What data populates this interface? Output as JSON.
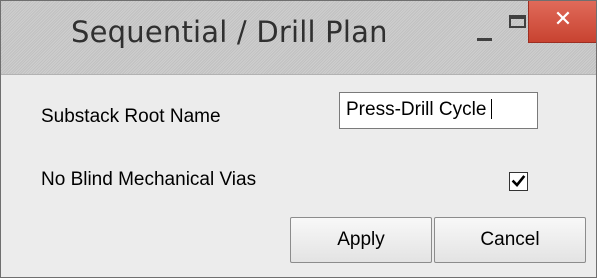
{
  "window": {
    "title": "Sequential / Drill Plan",
    "controls": {
      "minimize_icon": "minimize-icon",
      "maximize_icon": "maximize-icon",
      "close_glyph": "✕",
      "close_color": "#d9533f"
    }
  },
  "form": {
    "substack_root_name": {
      "label": "Substack Root Name",
      "value": "Press-Drill Cycle"
    },
    "no_blind_mechanical_vias": {
      "label": "No Blind Mechanical Vias",
      "checked": true
    }
  },
  "buttons": {
    "apply_label": "Apply",
    "cancel_label": "Cancel"
  }
}
